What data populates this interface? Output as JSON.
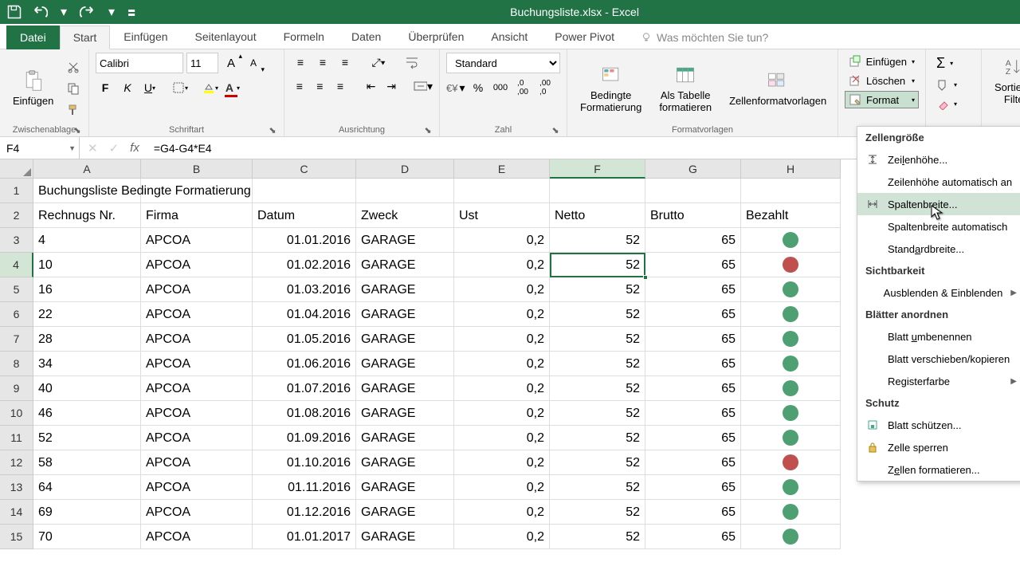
{
  "app": {
    "title": "Buchungsliste.xlsx - Excel"
  },
  "tabs": {
    "file": "Datei",
    "start": "Start",
    "einfuegen": "Einfügen",
    "seitenlayout": "Seitenlayout",
    "formeln": "Formeln",
    "daten": "Daten",
    "ueberpruefen": "Überprüfen",
    "ansicht": "Ansicht",
    "powerpivot": "Power Pivot",
    "tellme": "Was möchten Sie tun?"
  },
  "ribbon": {
    "zwischenablage": {
      "label": "Zwischenablage",
      "einfuegen": "Einfügen"
    },
    "schriftart": {
      "label": "Schriftart",
      "font": "Calibri",
      "size": "11"
    },
    "ausrichtung": {
      "label": "Ausrichtung"
    },
    "zahl": {
      "label": "Zahl",
      "format": "Standard",
      "percent": "%",
      "thousand": "000"
    },
    "formatvorlagen": {
      "label": "Formatvorlagen",
      "bedingte": "Bedingte Formatierung",
      "tabelle": "Als Tabelle formatieren",
      "zellen": "Zellenformatvorlagen"
    },
    "zellen": {
      "einfuegen": "Einfügen",
      "loeschen": "Löschen",
      "format": "Format"
    },
    "bearbeiten": {
      "sortieren": "Sortieren Filter"
    }
  },
  "namebox": "F4",
  "formula": "=G4-G4*E4",
  "columns": [
    "A",
    "B",
    "C",
    "D",
    "E",
    "F",
    "G",
    "H"
  ],
  "rows": [
    "1",
    "2",
    "3",
    "4",
    "5",
    "6",
    "7",
    "8",
    "9",
    "10",
    "11",
    "12",
    "13",
    "14",
    "15"
  ],
  "selected_col": "F",
  "selected_row": "4",
  "title_cell": "Buchungsliste Bedingte Formatierung",
  "headers": {
    "A": "Rechnugs Nr.",
    "B": "Firma",
    "C": "Datum",
    "D": "Zweck",
    "E": "Ust",
    "F": "Netto",
    "G": "Brutto",
    "H": "Bezahlt"
  },
  "data": [
    {
      "nr": "4",
      "firma": "APCOA",
      "datum": "01.01.2016",
      "zweck": "GARAGE",
      "ust": "0,2",
      "netto": "52",
      "brutto": "65",
      "bez": "green"
    },
    {
      "nr": "10",
      "firma": "APCOA",
      "datum": "01.02.2016",
      "zweck": "GARAGE",
      "ust": "0,2",
      "netto": "52",
      "brutto": "65",
      "bez": "red"
    },
    {
      "nr": "16",
      "firma": "APCOA",
      "datum": "01.03.2016",
      "zweck": "GARAGE",
      "ust": "0,2",
      "netto": "52",
      "brutto": "65",
      "bez": "green"
    },
    {
      "nr": "22",
      "firma": "APCOA",
      "datum": "01.04.2016",
      "zweck": "GARAGE",
      "ust": "0,2",
      "netto": "52",
      "brutto": "65",
      "bez": "green"
    },
    {
      "nr": "28",
      "firma": "APCOA",
      "datum": "01.05.2016",
      "zweck": "GARAGE",
      "ust": "0,2",
      "netto": "52",
      "brutto": "65",
      "bez": "green"
    },
    {
      "nr": "34",
      "firma": "APCOA",
      "datum": "01.06.2016",
      "zweck": "GARAGE",
      "ust": "0,2",
      "netto": "52",
      "brutto": "65",
      "bez": "green"
    },
    {
      "nr": "40",
      "firma": "APCOA",
      "datum": "01.07.2016",
      "zweck": "GARAGE",
      "ust": "0,2",
      "netto": "52",
      "brutto": "65",
      "bez": "green"
    },
    {
      "nr": "46",
      "firma": "APCOA",
      "datum": "01.08.2016",
      "zweck": "GARAGE",
      "ust": "0,2",
      "netto": "52",
      "brutto": "65",
      "bez": "green"
    },
    {
      "nr": "52",
      "firma": "APCOA",
      "datum": "01.09.2016",
      "zweck": "GARAGE",
      "ust": "0,2",
      "netto": "52",
      "brutto": "65",
      "bez": "green"
    },
    {
      "nr": "58",
      "firma": "APCOA",
      "datum": "01.10.2016",
      "zweck": "GARAGE",
      "ust": "0,2",
      "netto": "52",
      "brutto": "65",
      "bez": "red"
    },
    {
      "nr": "64",
      "firma": "APCOA",
      "datum": "01.11.2016",
      "zweck": "GARAGE",
      "ust": "0,2",
      "netto": "52",
      "brutto": "65",
      "bez": "green"
    },
    {
      "nr": "69",
      "firma": "APCOA",
      "datum": "01.12.2016",
      "zweck": "GARAGE",
      "ust": "0,2",
      "netto": "52",
      "brutto": "65",
      "bez": "green"
    },
    {
      "nr": "70",
      "firma": "APCOA",
      "datum": "01.01.2017",
      "zweck": "GARAGE",
      "ust": "0,2",
      "netto": "52",
      "brutto": "65",
      "bez": "green"
    }
  ],
  "format_menu": {
    "groups": [
      {
        "header": "Zellengröße",
        "items": [
          {
            "label": "Zeilenhöhe...",
            "icon": "row-height",
            "underline": 3
          },
          {
            "label": "Zeilenhöhe automatisch an"
          },
          {
            "label": "Spaltenbreite...",
            "icon": "col-width",
            "hover": true
          },
          {
            "label": "Spaltenbreite automatisch"
          },
          {
            "label": "Standardbreite...",
            "underline": 5
          }
        ]
      },
      {
        "header": "Sichtbarkeit",
        "items": [
          {
            "label": "Ausblenden & Einblenden",
            "arrow": true
          }
        ]
      },
      {
        "header": "Blätter anordnen",
        "items": [
          {
            "label": "Blatt umbenennen",
            "underline": 6
          },
          {
            "label": "Blatt verschieben/kopieren"
          },
          {
            "label": "Registerfarbe",
            "arrow": true
          }
        ]
      },
      {
        "header": "Schutz",
        "items": [
          {
            "label": "Blatt schützen...",
            "icon": "protect"
          },
          {
            "label": "Zelle sperren",
            "icon": "lock"
          },
          {
            "label": "Zellen formatieren...",
            "underline": 1
          }
        ]
      }
    ]
  }
}
